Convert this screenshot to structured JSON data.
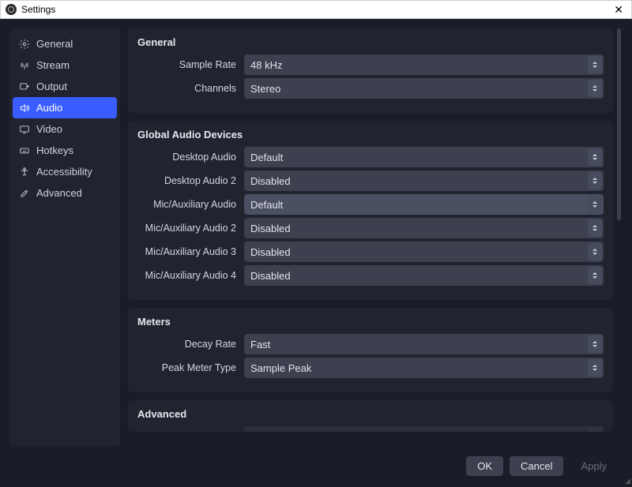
{
  "window": {
    "title": "Settings"
  },
  "sidebar": {
    "items": [
      {
        "label": "General"
      },
      {
        "label": "Stream"
      },
      {
        "label": "Output"
      },
      {
        "label": "Audio"
      },
      {
        "label": "Video"
      },
      {
        "label": "Hotkeys"
      },
      {
        "label": "Accessibility"
      },
      {
        "label": "Advanced"
      }
    ]
  },
  "panels": {
    "general": {
      "title": "General",
      "sample_rate": {
        "label": "Sample Rate",
        "value": "48 kHz"
      },
      "channels": {
        "label": "Channels",
        "value": "Stereo"
      }
    },
    "devices": {
      "title": "Global Audio Devices",
      "desktop1": {
        "label": "Desktop Audio",
        "value": "Default"
      },
      "desktop2": {
        "label": "Desktop Audio 2",
        "value": "Disabled"
      },
      "mic1": {
        "label": "Mic/Auxiliary Audio",
        "value": "Default"
      },
      "mic2": {
        "label": "Mic/Auxiliary Audio 2",
        "value": "Disabled"
      },
      "mic3": {
        "label": "Mic/Auxiliary Audio 3",
        "value": "Disabled"
      },
      "mic4": {
        "label": "Mic/Auxiliary Audio 4",
        "value": "Disabled"
      }
    },
    "meters": {
      "title": "Meters",
      "decay": {
        "label": "Decay Rate",
        "value": "Fast"
      },
      "peak": {
        "label": "Peak Meter Type",
        "value": "Sample Peak"
      }
    },
    "advanced": {
      "title": "Advanced"
    }
  },
  "footer": {
    "ok": "OK",
    "cancel": "Cancel",
    "apply": "Apply"
  }
}
